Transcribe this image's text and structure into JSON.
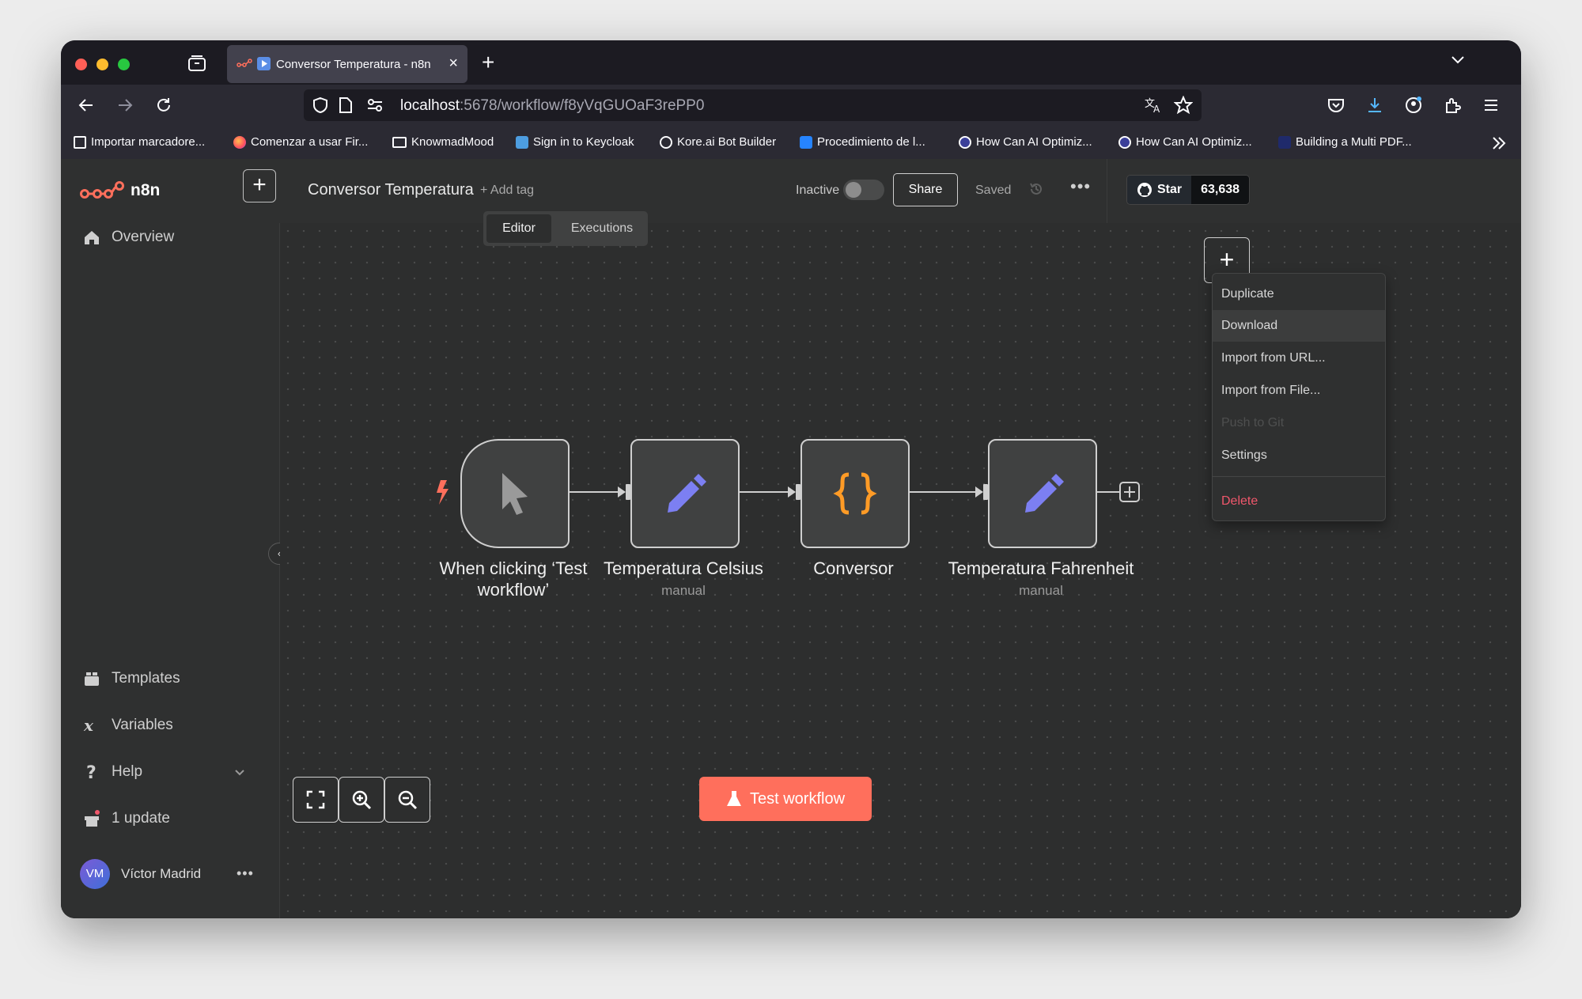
{
  "browser": {
    "tab_title": "Conversor Temperatura - n8n",
    "url_host": "localhost",
    "url_path": ":5678/workflow/f8yVqGUOaF3rePP0",
    "bookmarks": [
      "Importar marcadore...",
      "Comenzar a usar Fir...",
      "KnowmadMood",
      "Sign in to Keycloak",
      "Kore.ai Bot Builder",
      "Procedimiento de l...",
      "How Can AI Optimiz...",
      "How Can AI Optimiz...",
      "Building a Multi PDF..."
    ]
  },
  "sidebar": {
    "logo_text": "n8n",
    "overview": "Overview",
    "templates": "Templates",
    "variables": "Variables",
    "help": "Help",
    "update": "1 update",
    "user_initials": "VM",
    "user_name": "Víctor Madrid"
  },
  "header": {
    "workflow_name": "Conversor Temperatura",
    "add_tag": "+ Add tag",
    "status_label": "Inactive",
    "share": "Share",
    "saved": "Saved",
    "github_star": "Star",
    "github_count": "63,638",
    "tab_editor": "Editor",
    "tab_executions": "Executions"
  },
  "menu": {
    "items": [
      "Duplicate",
      "Download",
      "Import from URL...",
      "Import from File...",
      "Push to Git",
      "Settings",
      "Delete"
    ],
    "active_item": "Download",
    "disabled_item": "Push to Git"
  },
  "nodes": [
    {
      "label": "When clicking ‘Test workflow’",
      "sub": "",
      "icon": "cursor-icon"
    },
    {
      "label": "Temperatura Celsius",
      "sub": "manual",
      "icon": "pencil-icon"
    },
    {
      "label": "Conversor",
      "sub": "",
      "icon": "braces-icon"
    },
    {
      "label": "Temperatura Fahrenheit",
      "sub": "manual",
      "icon": "pencil-icon"
    }
  ],
  "canvas": {
    "test_workflow": "Test workflow"
  },
  "colors": {
    "accent": "#ff6f5c",
    "node_icon_purple": "#7c7ff2",
    "code_icon_orange": "#ff9b26",
    "danger": "#f0576b"
  }
}
